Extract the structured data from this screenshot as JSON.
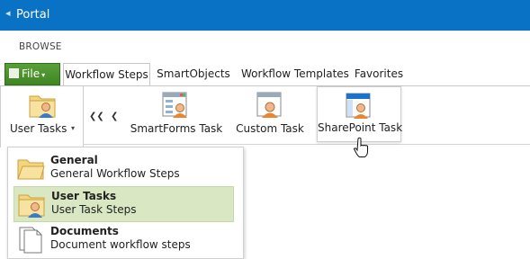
{
  "titlebar": {
    "back_glyph": "◂",
    "title": "Portal"
  },
  "section_label": "BROWSE",
  "file_button": {
    "label": "File",
    "caret": "▾"
  },
  "tabs": [
    {
      "label": "Workflow Steps",
      "active": true
    },
    {
      "label": "SmartObjects"
    },
    {
      "label": "Workflow Templates"
    },
    {
      "label": "Favorites"
    }
  ],
  "ribbon": {
    "user_tasks": {
      "label": "User Tasks",
      "arrow": "▾"
    },
    "nav": {
      "first": "❮❮",
      "prev": "❮"
    },
    "items": [
      {
        "label": "SmartForms Task",
        "icon": "smartforms-task-icon"
      },
      {
        "label": "Custom Task",
        "icon": "custom-task-icon"
      },
      {
        "label": "SharePoint Task",
        "icon": "sharepoint-task-icon"
      }
    ]
  },
  "dropdown": {
    "items": [
      {
        "title": "General",
        "subtitle": "General Workflow Steps",
        "icon": "folder-icon"
      },
      {
        "title": "User Tasks",
        "subtitle": "User Task Steps",
        "icon": "folder-user-icon",
        "selected": true
      },
      {
        "title": "Documents",
        "subtitle": "Document workflow steps",
        "icon": "documents-icon"
      }
    ]
  },
  "colors": {
    "titlebar": "#0a72c4",
    "file_button": "#4a9330",
    "selected_item": "#d9e8c3"
  }
}
